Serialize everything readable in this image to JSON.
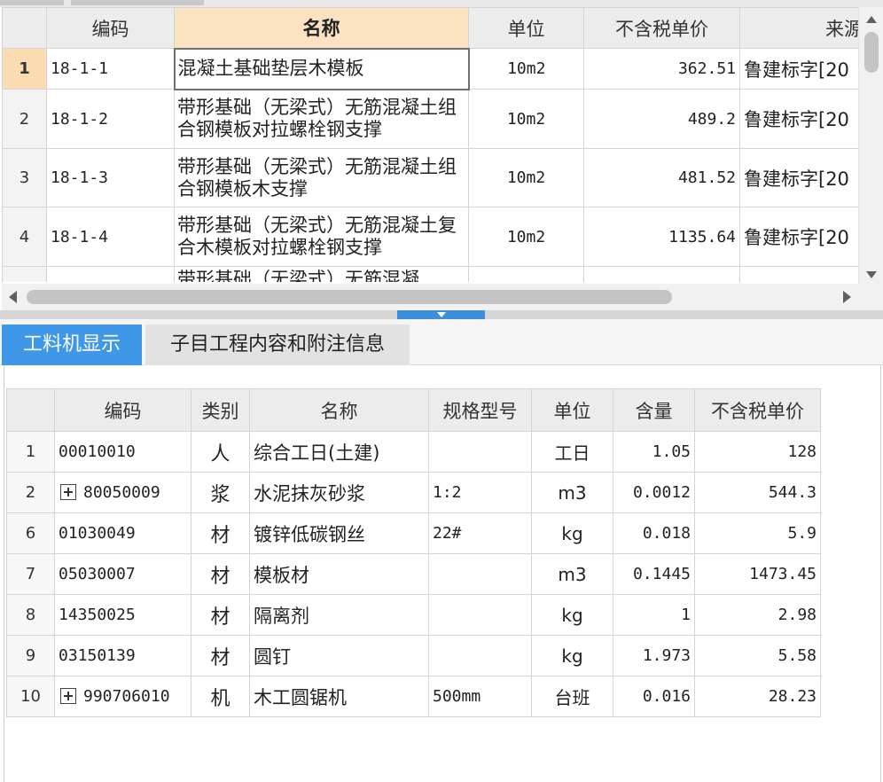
{
  "top_grid": {
    "columns": [
      "编码",
      "名称",
      "单位",
      "不含税单价",
      "来源"
    ],
    "rows": [
      {
        "index": "1",
        "code": "18-1-1",
        "name": "混凝土基础垫层木模板",
        "unit": "10m2",
        "price": "362.51",
        "source": "鲁建标字[20"
      },
      {
        "index": "2",
        "code": "18-1-2",
        "name": "带形基础（无梁式）无筋混凝土组合钢模板对拉螺栓钢支撑",
        "unit": "10m2",
        "price": "489.2",
        "source": "鲁建标字[20"
      },
      {
        "index": "3",
        "code": "18-1-3",
        "name": "带形基础（无梁式）无筋混凝土组合钢模板木支撑",
        "unit": "10m2",
        "price": "481.52",
        "source": "鲁建标字[20"
      },
      {
        "index": "4",
        "code": "18-1-4",
        "name": "带形基础（无梁式）无筋混凝土复合木模板对拉螺栓钢支撑",
        "unit": "10m2",
        "price": "1135.64",
        "source": "鲁建标字[20"
      },
      {
        "index": "",
        "code": "",
        "name": "带形基础（无梁式）无筋混凝",
        "unit": "",
        "price": "",
        "source": ""
      }
    ]
  },
  "tabs": [
    {
      "label": "工料机显示",
      "active": true
    },
    {
      "label": "子目工程内容和附注信息",
      "active": false
    }
  ],
  "bottom_grid": {
    "columns": [
      "编码",
      "类别",
      "名称",
      "规格型号",
      "单位",
      "含量",
      "不含税单价"
    ],
    "rows": [
      {
        "index": "1",
        "expandable": false,
        "code": "00010010",
        "category": "人",
        "name": "综合工日(土建)",
        "spec": "",
        "unit": "工日",
        "quantity": "1.05",
        "price": "128"
      },
      {
        "index": "2",
        "expandable": true,
        "code": "80050009",
        "category": "浆",
        "name": "水泥抹灰砂浆",
        "spec": "1:2",
        "unit": "m3",
        "quantity": "0.0012",
        "price": "544.3"
      },
      {
        "index": "6",
        "expandable": false,
        "code": "01030049",
        "category": "材",
        "name": "镀锌低碳钢丝",
        "spec": "22#",
        "unit": "kg",
        "quantity": "0.018",
        "price": "5.9"
      },
      {
        "index": "7",
        "expandable": false,
        "code": "05030007",
        "category": "材",
        "name": "模板材",
        "spec": "",
        "unit": "m3",
        "quantity": "0.1445",
        "price": "1473.45"
      },
      {
        "index": "8",
        "expandable": false,
        "code": "14350025",
        "category": "材",
        "name": "隔离剂",
        "spec": "",
        "unit": "kg",
        "quantity": "1",
        "price": "2.98"
      },
      {
        "index": "9",
        "expandable": false,
        "code": "03150139",
        "category": "材",
        "name": "圆钉",
        "spec": "",
        "unit": "kg",
        "quantity": "1.973",
        "price": "5.58"
      },
      {
        "index": "10",
        "expandable": true,
        "code": "990706010",
        "category": "机",
        "name": "木工圆锯机",
        "spec": "500mm",
        "unit": "台班",
        "quantity": "0.016",
        "price": "28.23"
      }
    ]
  },
  "colors": {
    "active_tab": "#3f97e8",
    "selected_header": "#fbe3c2",
    "selected_row_index": "#fbdcb2",
    "splitter_grip": "#3c8fd8"
  }
}
